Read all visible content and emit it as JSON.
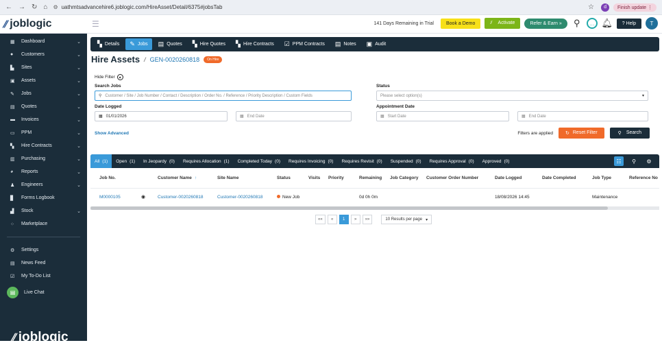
{
  "browser": {
    "url": "uathmtsadvancehire6.joblogic.com/HireAsset/Detail/6375#jobsTab",
    "finish_update": "Finish update",
    "profile_initial": "d"
  },
  "app": {
    "logo_text": "joblogic",
    "trial_text": "141 Days Remaining in Trial",
    "book_demo": "Book a Demo",
    "activate": "Activate",
    "refer": "Refer & Earn »",
    "help": "Help",
    "avatar": "T"
  },
  "sidebar": {
    "items": [
      {
        "label": "Dashboard",
        "icon": "dashboard-icon",
        "glyph": "▦",
        "chevron": true
      },
      {
        "label": "Customers",
        "icon": "customers-icon",
        "glyph": "●",
        "chevron": true
      },
      {
        "label": "Sites",
        "icon": "sites-icon",
        "glyph": "▙",
        "chevron": true
      },
      {
        "label": "Assets",
        "icon": "assets-icon",
        "glyph": "▣",
        "chevron": true
      },
      {
        "label": "Jobs",
        "icon": "jobs-icon",
        "glyph": "✎",
        "chevron": true
      },
      {
        "label": "Quotes",
        "icon": "quotes-icon",
        "glyph": "▤",
        "chevron": true
      },
      {
        "label": "Invoices",
        "icon": "invoices-icon",
        "glyph": "▬",
        "chevron": true
      },
      {
        "label": "PPM",
        "icon": "ppm-icon",
        "glyph": "▭",
        "chevron": true
      },
      {
        "label": "Hire Contracts",
        "icon": "hire-contracts-icon",
        "glyph": "▚",
        "chevron": true
      },
      {
        "label": "Purchasing",
        "icon": "purchasing-icon",
        "glyph": "▥",
        "chevron": true
      },
      {
        "label": "Reports",
        "icon": "reports-icon",
        "glyph": "◕",
        "chevron": true
      },
      {
        "label": "Engineers",
        "icon": "engineers-icon",
        "glyph": "♟",
        "chevron": true
      },
      {
        "label": "Forms Logbook",
        "icon": "forms-icon",
        "glyph": "▊",
        "chevron": false
      },
      {
        "label": "Stock",
        "icon": "stock-icon",
        "glyph": "▟",
        "chevron": true
      },
      {
        "label": "Marketplace",
        "icon": "marketplace-icon",
        "glyph": "⁘",
        "chevron": false
      }
    ],
    "bottom_items": [
      {
        "label": "Settings",
        "icon": "settings-icon",
        "glyph": "⚙"
      },
      {
        "label": "News Feed",
        "icon": "news-feed-icon",
        "glyph": "▤"
      },
      {
        "label": "My To-Do List",
        "icon": "todo-icon",
        "glyph": "☑"
      }
    ],
    "live_chat": "Live Chat",
    "footer_logo": "joblogic"
  },
  "tabs": [
    {
      "label": "Details",
      "icon": "details-icon",
      "glyph": "▚",
      "active": false
    },
    {
      "label": "Jobs",
      "icon": "jobs-tab-icon",
      "glyph": "✎",
      "active": true
    },
    {
      "label": "Quotes",
      "icon": "quotes-tab-icon",
      "glyph": "▤",
      "active": false
    },
    {
      "label": "Hire Quotes",
      "icon": "hire-quotes-icon",
      "glyph": "▚",
      "active": false
    },
    {
      "label": "Hire Contracts",
      "icon": "hire-contracts-tab-icon",
      "glyph": "▚",
      "active": false
    },
    {
      "label": "PPM Contracts",
      "icon": "ppm-contracts-icon",
      "glyph": "☑",
      "active": false
    },
    {
      "label": "Notes",
      "icon": "notes-icon",
      "glyph": "▤",
      "active": false
    },
    {
      "label": "Audit",
      "icon": "audit-icon",
      "glyph": "▣",
      "active": false
    }
  ],
  "page": {
    "title": "Hire Assets",
    "sep": "/",
    "asset_code": "GEN-0020260818",
    "badge": "On Hire"
  },
  "filters": {
    "hide_filter": "Hide Filter",
    "search_label": "Search Jobs",
    "search_placeholder": "Customer / Site / Job Number / Contact / Description / Order No. / Reference / Priority Description / Custom Fields",
    "status_label": "Status",
    "status_placeholder": "Please select option(s)",
    "date_logged_label": "Date Logged",
    "date_logged_start": "01/01/2026",
    "date_logged_end": "End Date",
    "appointment_label": "Appointment Date",
    "appointment_start": "Start Date",
    "appointment_end": "End Date",
    "show_advanced": "Show Advanced",
    "filters_applied": "Filters are applied",
    "reset": "Reset Filter",
    "search": "Search"
  },
  "status_tabs": [
    {
      "label": "All",
      "count": "(1)",
      "active": true
    },
    {
      "label": "Open",
      "count": "(1)"
    },
    {
      "label": "In Jeopardy",
      "count": "(0)"
    },
    {
      "label": "Requires Allocation",
      "count": "(1)"
    },
    {
      "label": "Completed Today",
      "count": "(0)"
    },
    {
      "label": "Requires Invoicing",
      "count": "(0)"
    },
    {
      "label": "Requires Revisit",
      "count": "(0)"
    },
    {
      "label": "Suspended",
      "count": "(0)"
    },
    {
      "label": "Requires Approval",
      "count": "(0)"
    },
    {
      "label": "Approved",
      "count": "(0)"
    }
  ],
  "table": {
    "columns": [
      "Job No.",
      "Customer Name",
      "Site Name",
      "Status",
      "Visits",
      "Priority",
      "Remaining",
      "Job Category",
      "Customer Order Number",
      "Date Logged",
      "Date Completed",
      "Job Type",
      "Reference No"
    ],
    "rows": [
      {
        "job_no": "M0000105",
        "customer": "Customer-0020260818",
        "site": "Customer-0020260818",
        "status": "New Job",
        "status_color": "#f06a2a",
        "visits": "",
        "priority": "",
        "remaining": "0d 0h 0m",
        "category": "",
        "order_no": "",
        "date_logged": "18/08/2026 14:45",
        "date_completed": "",
        "job_type": "Maintenance",
        "reference": ""
      }
    ]
  },
  "pager": {
    "first": "««",
    "prev": "«",
    "page": "1",
    "next": "»",
    "last": "»»",
    "per_page": "10 Results per page"
  }
}
